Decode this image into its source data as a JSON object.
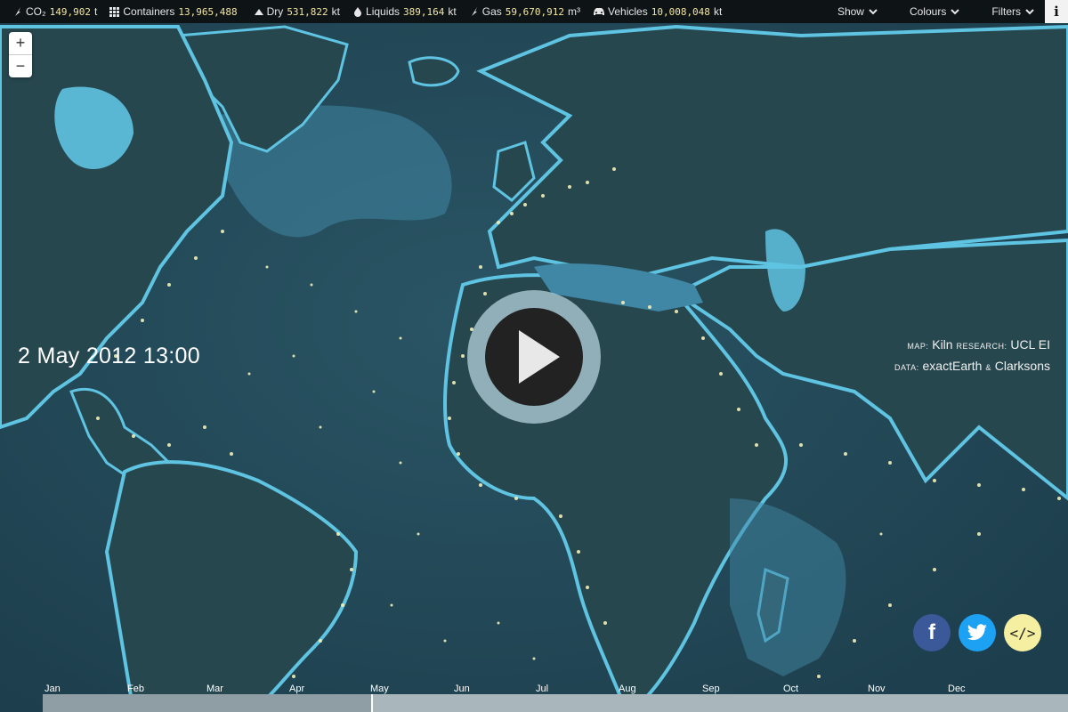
{
  "stats": [
    {
      "icon": "co2-icon",
      "label": "CO₂",
      "value": "149,902",
      "unit": "t"
    },
    {
      "icon": "containers-icon",
      "label": "Containers",
      "value": "13,965,488",
      "unit": ""
    },
    {
      "icon": "dry-icon",
      "label": "Dry",
      "value": "531,822",
      "unit": "kt"
    },
    {
      "icon": "liquids-icon",
      "label": "Liquids",
      "value": "389,164",
      "unit": "kt"
    },
    {
      "icon": "gas-icon",
      "label": "Gas",
      "value": "59,670,912",
      "unit": "m³"
    },
    {
      "icon": "vehicles-icon",
      "label": "Vehicles",
      "value": "10,008,048",
      "unit": "kt"
    }
  ],
  "menus": {
    "show": "Show",
    "colours": "Colours",
    "filters": "Filters"
  },
  "info_label": "i",
  "zoom": {
    "in": "+",
    "out": "−"
  },
  "date": "2 May 2012 13:00",
  "credits": {
    "map_label": "Map:",
    "map_value": "Kiln",
    "research_label": "Research:",
    "research_value": "UCL EI",
    "data_label": "Data:",
    "data_value": "exactEarth",
    "data_amp": "&",
    "data_value2": "Clarksons"
  },
  "months": [
    "Jan",
    "Feb",
    "Mar",
    "Apr",
    "May",
    "Jun",
    "Jul",
    "Aug",
    "Sep",
    "Oct",
    "Nov",
    "Dec"
  ],
  "timeline_progress": 0.32,
  "colors": {
    "ocean": "#1d3e4c",
    "land": "#27474f",
    "shelf": "#5fc3e2",
    "ships": "#f3f0b8",
    "topbar": "#0e1316"
  },
  "social": {
    "facebook": "f",
    "twitter": "twitter",
    "embed": "</>"
  }
}
